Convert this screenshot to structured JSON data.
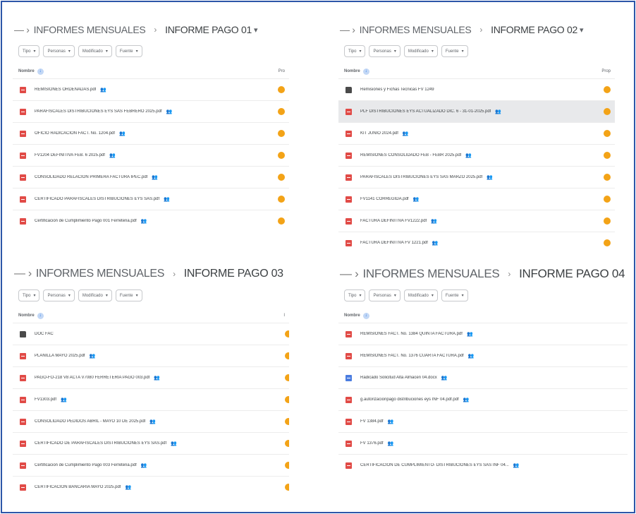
{
  "panels": [
    {
      "breadcrumb": {
        "root": "INFORMES MENSUALES",
        "current": "INFORME PAGO 01",
        "has_caret": true
      },
      "filters": [
        "Tipo",
        "Personas",
        "Modificado",
        "Fuente"
      ],
      "header": {
        "name": "Nombre",
        "owner": "Pro"
      },
      "files": [
        {
          "icon": "pdf-icon",
          "name": "REMISIONES ORDENADAS.pdf",
          "selected": false
        },
        {
          "icon": "pdf-icon",
          "name": "PARAFISCALES DISTRIBUCIONES EYS SAS FEBRERO 2025.pdf",
          "selected": false
        },
        {
          "icon": "pdf-icon",
          "name": "OFICIO RADICACION FACT. No. 1204.pdf",
          "selected": false
        },
        {
          "icon": "pdf-icon",
          "name": "FV1204 DEFINITIVA FEB. 6 2025.pdf",
          "selected": false
        },
        {
          "icon": "pdf-icon",
          "name": "CONSOLIDADO RELACION PRIMERA FACTURA IPEC.pdf",
          "selected": false
        },
        {
          "icon": "pdf-icon",
          "name": "CERTIFICADO PARAFISCALES DISTRIBUCIONES EYS SAS.pdf",
          "selected": false
        },
        {
          "icon": "pdf-icon",
          "name": "Certificacion de Cumplimiento Pago 001 Ferreteria.pdf",
          "selected": false
        }
      ]
    },
    {
      "breadcrumb": {
        "root": "INFORMES MENSUALES",
        "current": "INFORME PAGO 02",
        "has_caret": true
      },
      "filters": [
        "Tipo",
        "Personas",
        "Modificado",
        "Fuente"
      ],
      "header": {
        "name": "Nombre",
        "owner": "Prop"
      },
      "files": [
        {
          "icon": "folder-icon",
          "name": "Remisiones y Fichas Tecnicas FV 1249",
          "selected": false
        },
        {
          "icon": "pdf-icon",
          "name": "PLF DISTRIBUCIONES EYS ACTUALIZADO DIC. 6 - 31-01-2025.pdf",
          "selected": true
        },
        {
          "icon": "pdf-icon",
          "name": "KIT JUNIO 2024.pdf",
          "selected": false
        },
        {
          "icon": "pdf-icon",
          "name": "REMISIONES CONSOLIDADO FEB - FEBR 2025.pdf",
          "selected": false
        },
        {
          "icon": "pdf-icon",
          "name": "PARAFISCALES DISTRIBUCIONES EYS SAS MARZO 2025.pdf",
          "selected": false
        },
        {
          "icon": "pdf-icon",
          "name": "FV1141 CORREGIDA.pdf",
          "selected": false
        },
        {
          "icon": "pdf-icon",
          "name": "FACTURA DEFINITIVA FV1222.pdf",
          "selected": false
        },
        {
          "icon": "pdf-icon",
          "name": "FACTURA DEFINITIVA FV 1221.pdf",
          "selected": false
        }
      ]
    },
    {
      "breadcrumb": {
        "root": "INFORMES MENSUALES",
        "current": "INFORME PAGO 03",
        "has_caret": false
      },
      "filters": [
        "Tipo",
        "Personas",
        "Modificado",
        "Fuente"
      ],
      "header": {
        "name": "Nombre",
        "owner": "I"
      },
      "files": [
        {
          "icon": "folder-icon",
          "name": "DOC FAC",
          "selected": false
        },
        {
          "icon": "pdf-icon",
          "name": "PLANILLA MAYO 2025.pdf",
          "selected": false
        },
        {
          "icon": "pdf-icon",
          "name": "PAGO-FO-218 V8 ACTA V7080 FERRETERIA PAGO 003.pdf",
          "selected": false
        },
        {
          "icon": "pdf-icon",
          "name": "FV1303.pdf",
          "selected": false
        },
        {
          "icon": "pdf-icon",
          "name": "CONSOLIDADO PEDIDOS ABRIL - MAYO 10 DE 2025.pdf",
          "selected": false
        },
        {
          "icon": "pdf-icon",
          "name": "CERTIFICADO DE PARAFISCALES DISTRIBUCIONES EYS SAS.pdf",
          "selected": false
        },
        {
          "icon": "pdf-icon",
          "name": "Certificacion de Cumplimiento Pago 003 Ferreteria.pdf",
          "selected": false
        },
        {
          "icon": "pdf-icon",
          "name": "CERTIFICACION BANCARIA MAYO 2025.pdf",
          "selected": false
        }
      ]
    },
    {
      "breadcrumb": {
        "root": "INFORMES MENSUALES",
        "current": "INFORME PAGO 04",
        "has_caret": false
      },
      "filters": [
        "Tipo",
        "Personas",
        "Modificado",
        "Fuente"
      ],
      "header": {
        "name": "Nombre",
        "owner": ""
      },
      "files": [
        {
          "icon": "pdf-icon",
          "name": "REMISIONES FACT. No. 1384 QUINTA FACTURA.pdf",
          "selected": false
        },
        {
          "icon": "pdf-icon",
          "name": "REMISIONES FACT. No. 1376 CUARTA FACTURA.pdf",
          "selected": false
        },
        {
          "icon": "doc-icon",
          "name": "Radicado Solicitud Alta Almacen 04.docx",
          "selected": false
        },
        {
          "icon": "pdf-icon",
          "name": "g.autorizacionpago distribuciones eys INF 04.pdf.pdf",
          "selected": false
        },
        {
          "icon": "pdf-icon",
          "name": "FV 1384.pdf",
          "selected": false
        },
        {
          "icon": "pdf-icon",
          "name": "FV 1376.pdf",
          "selected": false
        },
        {
          "icon": "pdf-icon",
          "name": "CERTIFICACION DE CUMPLIMIENTO- DISTRIBUCIONES EYS SAS INF 04...",
          "selected": false
        }
      ]
    }
  ],
  "colors": {
    "frame_border": "#2d56a8",
    "pdf_icon": "#e14b47",
    "doc_icon": "#4b7de0",
    "owner_avatar": "#f3a317",
    "selected_row": "#e8e9eb"
  }
}
